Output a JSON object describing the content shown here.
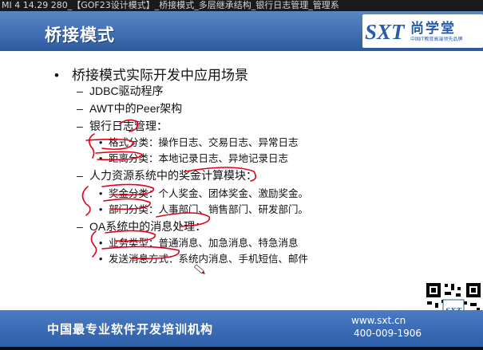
{
  "window": {
    "title": "MI 4 14.29 280_【GOF23设计模式】_桥接模式_多层继承结构_银行日志管理_管理系"
  },
  "slide": {
    "title": "桥接模式",
    "logo": {
      "name": "尚学堂",
      "tagline": "中国IT教育高端领先品牌",
      "mark": "SXT"
    },
    "bullets": [
      {
        "level": 1,
        "marker": "•",
        "text": "桥接模式实际开发中应用场景"
      },
      {
        "level": 2,
        "marker": "–",
        "text": "JDBC驱动程序"
      },
      {
        "level": 2,
        "marker": "–",
        "text": "AWT中的Peer架构"
      },
      {
        "level": 2,
        "marker": "–",
        "text": "银行日志管理："
      },
      {
        "level": 3,
        "marker": "•",
        "text": "格式分类：操作日志、交易日志、异常日志"
      },
      {
        "level": 3,
        "marker": "•",
        "text": "距离分类：本地记录日志、异地记录日志"
      },
      {
        "level": 2,
        "marker": "–",
        "text": "人力资源系统中的奖金计算模块："
      },
      {
        "level": 3,
        "marker": "•",
        "text": "奖金分类：个人奖金、团体奖金、激励奖金。"
      },
      {
        "level": 3,
        "marker": "•",
        "text": "部门分类：人事部门、销售部门、研发部门。"
      },
      {
        "level": 2,
        "marker": "–",
        "text": "OA系统中的消息处理："
      },
      {
        "level": 3,
        "marker": "•",
        "text": "业务类型：普通消息、加急消息、特急消息"
      },
      {
        "level": 3,
        "marker": "•",
        "text": "发送消息方式：系统内消息、手机短信、邮件"
      }
    ],
    "qr_badge": "SXT"
  },
  "footer": {
    "slogan": "中国最专业软件开发培训机构",
    "website": "www.sxt.cn",
    "phone": "400-009-1906"
  },
  "colors": {
    "header_blue": "#3e6db1",
    "footer_blue": "#2d5ea9",
    "annotation_red": "#e0001a",
    "logo_blue": "#2a5ba8"
  }
}
